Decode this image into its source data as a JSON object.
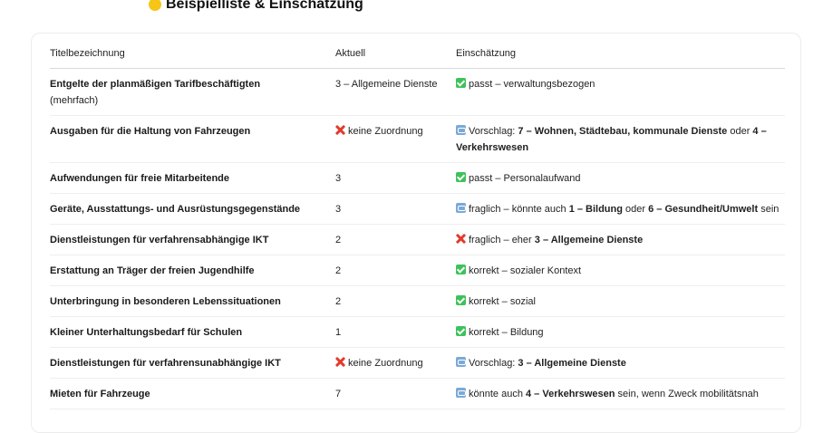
{
  "heading": {
    "title": "Beispielliste & Einschätzung",
    "icon": "face-emoji-icon"
  },
  "table": {
    "headers": [
      "Titelbezeichnung",
      "Aktuell",
      "Einschätzung"
    ],
    "rows": [
      {
        "title": "Entgelte der planmäßigen Tarifbeschäftigten",
        "title_sub": "(mehrfach)",
        "aktuell": "3 – Allgemeine Dienste",
        "aktuell_icon": "",
        "eval_icon": "check",
        "eval": [
          "passt – verwaltungsbezogen"
        ]
      },
      {
        "title": "Ausgaben für die Haltung von Fahrzeugen",
        "title_sub": "",
        "aktuell": "keine Zuordnung",
        "aktuell_icon": "cross",
        "eval_icon": "arrows",
        "eval": [
          "Vorschlag: ",
          "7 – Wohnen, Städtebau, kommunale Dienste",
          " oder ",
          "4 – Verkehrswesen"
        ]
      },
      {
        "title": "Aufwendungen für freie Mitarbeitende",
        "title_sub": "",
        "aktuell": "3",
        "aktuell_icon": "",
        "eval_icon": "check",
        "eval": [
          "passt – Personalaufwand"
        ]
      },
      {
        "title": "Geräte, Ausstattungs- und Ausrüstungsgegenstände",
        "title_sub": "",
        "aktuell": "3",
        "aktuell_icon": "",
        "eval_icon": "arrows",
        "eval": [
          "fraglich – könnte auch ",
          "1 – Bildung",
          " oder ",
          "6 – Gesundheit/Umwelt",
          " sein"
        ]
      },
      {
        "title": "Dienstleistungen für verfahrensabhängige IKT",
        "title_sub": "",
        "aktuell": "2",
        "aktuell_icon": "",
        "eval_icon": "cross",
        "eval": [
          "fraglich – eher ",
          "3 – Allgemeine Dienste"
        ]
      },
      {
        "title": "Erstattung an Träger der freien Jugendhilfe",
        "title_sub": "",
        "aktuell": "2",
        "aktuell_icon": "",
        "eval_icon": "check",
        "eval": [
          "korrekt – sozialer Kontext"
        ]
      },
      {
        "title": "Unterbringung in besonderen Lebenssituationen",
        "title_sub": "",
        "aktuell": "2",
        "aktuell_icon": "",
        "eval_icon": "check",
        "eval": [
          "korrekt – sozial"
        ]
      },
      {
        "title": "Kleiner Unterhaltungsbedarf für Schulen",
        "title_sub": "",
        "aktuell": "1",
        "aktuell_icon": "",
        "eval_icon": "check",
        "eval": [
          "korrekt – Bildung"
        ]
      },
      {
        "title": "Dienstleistungen für verfahrensunabhängige IKT",
        "title_sub": "",
        "aktuell": "keine Zuordnung",
        "aktuell_icon": "cross",
        "eval_icon": "arrows",
        "eval": [
          "Vorschlag: ",
          "3 – Allgemeine Dienste"
        ]
      },
      {
        "title": "Mieten für Fahrzeuge",
        "title_sub": "",
        "aktuell": "7",
        "aktuell_icon": "",
        "eval_icon": "arrows",
        "eval": [
          "könnte auch ",
          "4 – Verkehrswesen",
          " sein, wenn Zweck mobilitätsnah"
        ]
      }
    ]
  },
  "colors": {
    "check": "#3ec25a",
    "cross": "#e23b2e",
    "arrows": "#7aa9d8"
  }
}
